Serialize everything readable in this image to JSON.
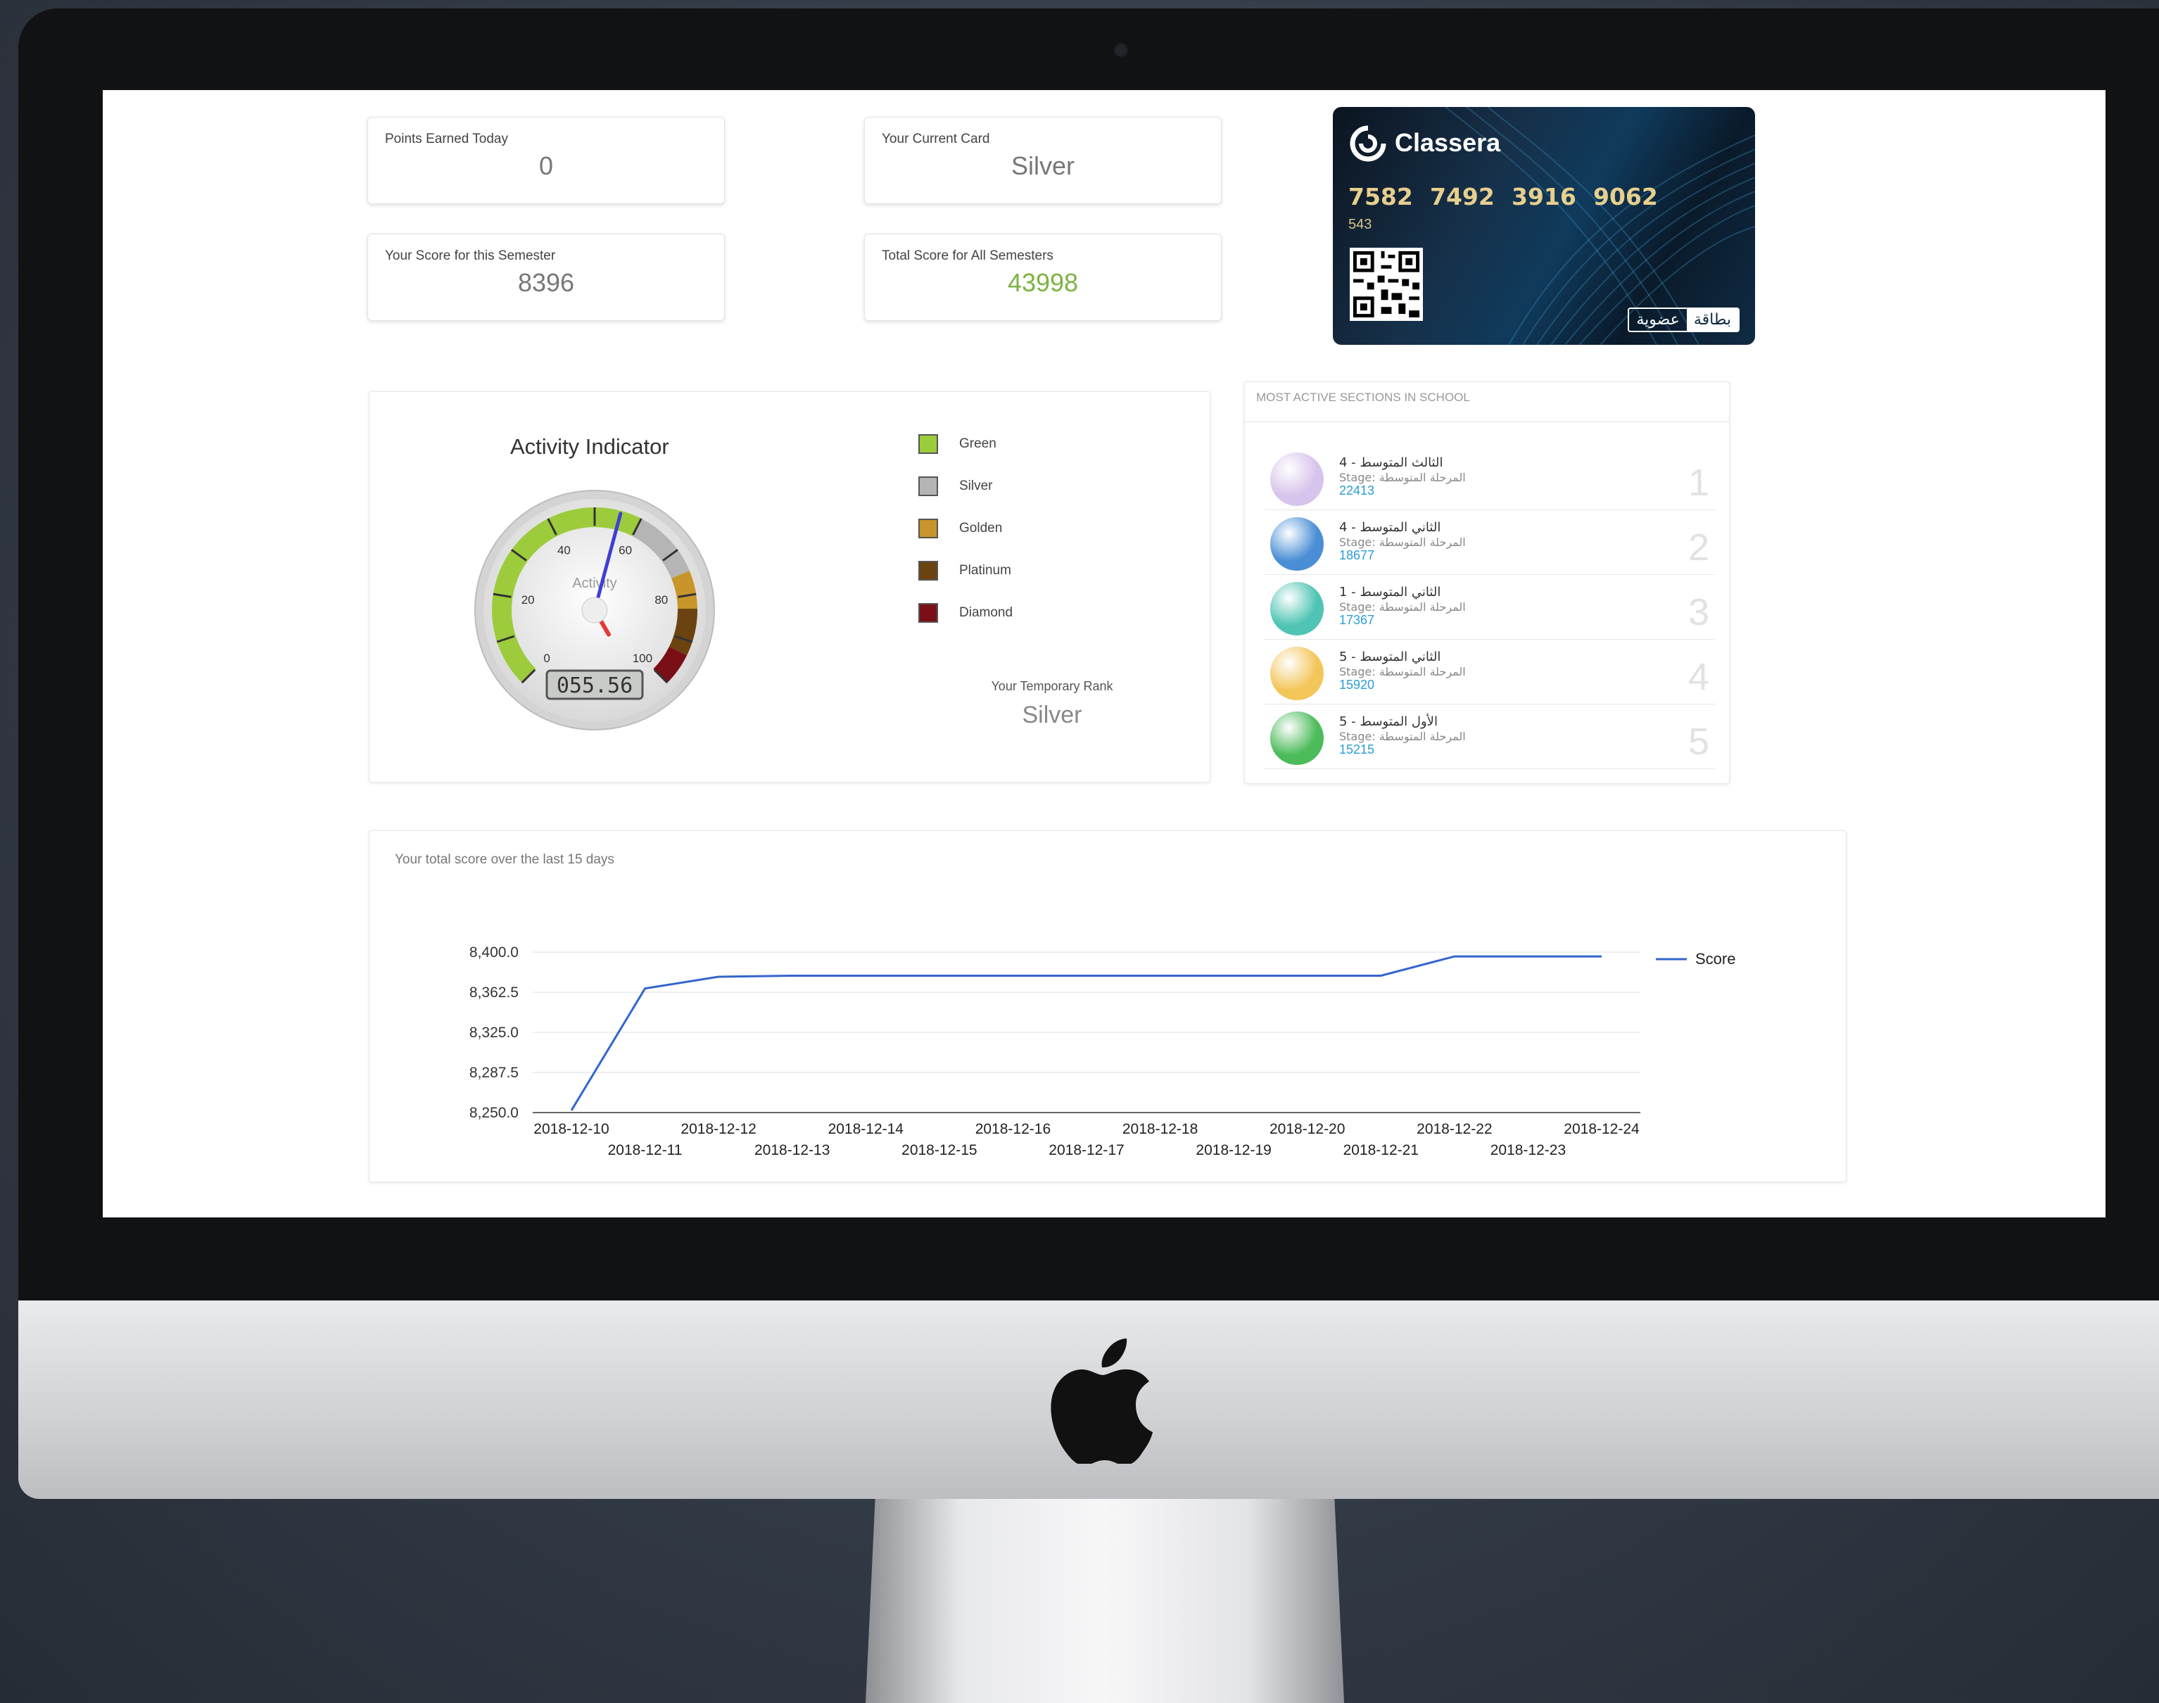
{
  "stats": {
    "points_today": {
      "label": "Points Earned Today",
      "value": "0"
    },
    "current_card": {
      "label": "Your Current Card",
      "value": "Silver"
    },
    "semester_score": {
      "label": "Your Score for this Semester",
      "value": "8396"
    },
    "total_score": {
      "label": "Total Score for All Semesters",
      "value": "43998"
    }
  },
  "membership_card": {
    "brand": "Classera",
    "numbers": [
      "7582",
      "7492",
      "3916",
      "9062"
    ],
    "sub_number": "543",
    "tag_left": "عضوية",
    "tag_right": "بطاقة"
  },
  "activity": {
    "title": "Activity Indicator",
    "gauge_label": "Activity",
    "gauge_value": 55.56,
    "gauge_display": "055.56",
    "gauge_ticks": [
      "0",
      "20",
      "40",
      "60",
      "80",
      "100"
    ],
    "legend": [
      {
        "label": "Green",
        "color": "#9ccc3c"
      },
      {
        "label": "Silver",
        "color": "#b5b5b5"
      },
      {
        "label": "Golden",
        "color": "#c8952a"
      },
      {
        "label": "Platinum",
        "color": "#6b4310"
      },
      {
        "label": "Diamond",
        "color": "#7a0f18"
      }
    ],
    "rank_label": "Your Temporary Rank",
    "rank_value": "Silver"
  },
  "sections": {
    "title": "MOST ACTIVE SECTIONS IN SCHOOL",
    "items": [
      {
        "name": "الثالث المتوسط - 4",
        "stage": "Stage: المرحلة المتوسطة",
        "count": "22413",
        "rank": "1",
        "color": "#d7c4ec"
      },
      {
        "name": "الثاني المتوسط - 4",
        "stage": "Stage: المرحلة المتوسطة",
        "count": "18677",
        "rank": "2",
        "color": "#4a8fd6"
      },
      {
        "name": "الثاني المتوسط - 1",
        "stage": "Stage: المرحلة المتوسطة",
        "count": "17367",
        "rank": "3",
        "color": "#4fc4b4"
      },
      {
        "name": "الثاني المتوسط - 5",
        "stage": "Stage: المرحلة المتوسطة",
        "count": "15920",
        "rank": "4",
        "color": "#f3c65a"
      },
      {
        "name": "الأول المتوسط - 5",
        "stage": "Stage: المرحلة المتوسطة",
        "count": "15215",
        "rank": "5",
        "color": "#4cbb5a"
      }
    ]
  },
  "score_chart": {
    "title": "Your total score over the last 15 days",
    "legend": "Score",
    "line_color": "#3366cc"
  },
  "chart_data": {
    "type": "line",
    "title": "Your total score over the last 15 days",
    "x": [
      "2018-12-10",
      "2018-12-11",
      "2018-12-12",
      "2018-12-13",
      "2018-12-14",
      "2018-12-15",
      "2018-12-16",
      "2018-12-17",
      "2018-12-18",
      "2018-12-19",
      "2018-12-20",
      "2018-12-21",
      "2018-12-22",
      "2018-12-23",
      "2018-12-24"
    ],
    "series": [
      {
        "name": "Score",
        "values": [
          8252,
          8366,
          8377,
          8378,
          8378,
          8378,
          8378,
          8378,
          8378,
          8378,
          8378,
          8378,
          8396,
          8396,
          8396
        ]
      }
    ],
    "ylim": [
      8250,
      8400
    ],
    "yticks": [
      "8,250.0",
      "8,287.5",
      "8,325.0",
      "8,362.5",
      "8,400.0"
    ],
    "grid": true,
    "legend_position": "right"
  }
}
